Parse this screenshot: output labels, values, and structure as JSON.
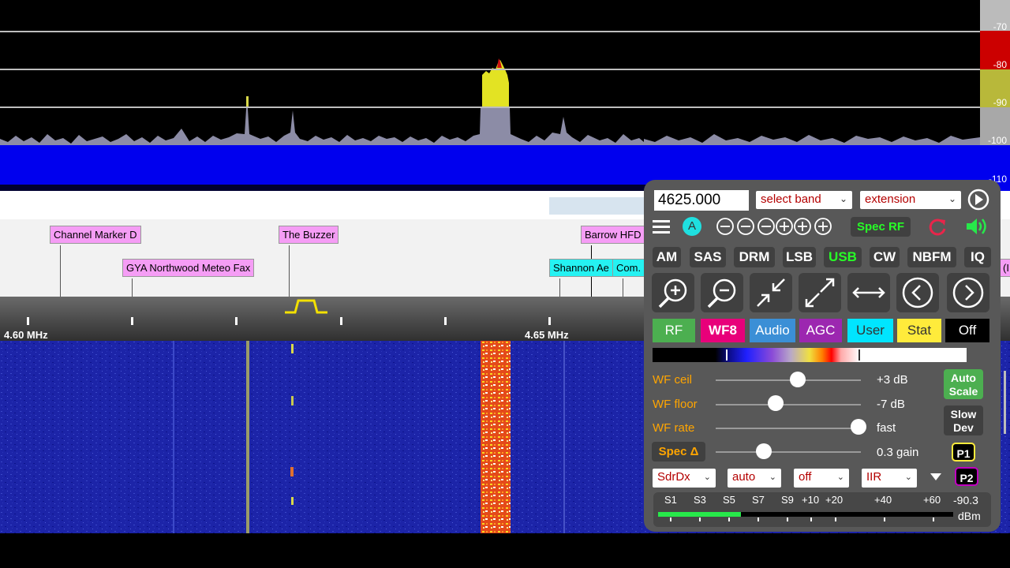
{
  "spectrum": {
    "db_scale": [
      "-70",
      "-80",
      "-90",
      "-100",
      "-110"
    ],
    "scale_colors": [
      "#bbbbbb",
      "#cc0000",
      "#b8b83a",
      "#a8a8a8",
      "#0000ee"
    ]
  },
  "markers": {
    "channel_marker_d": "Channel Marker D",
    "the_buzzer": "The Buzzer",
    "barrow_hfd": "Barrow HFD",
    "gya_northwood": "GYA Northwood Meteo Fax",
    "shannon": "Shannon Ae",
    "com": "Com.",
    "edge_partial": "(I"
  },
  "scale": {
    "left_label": "4.60 MHz",
    "mid_label": "4.65 MHz"
  },
  "controls": {
    "frequency": "4625.000",
    "select_band": "select band",
    "extension": "extension",
    "vfo": "A",
    "spec_rf": "Spec RF",
    "modes": [
      "AM",
      "SAS",
      "DRM",
      "LSB",
      "USB",
      "CW",
      "NBFM",
      "IQ"
    ],
    "active_mode": "USB",
    "tabs": [
      "RF",
      "WF8",
      "Audio",
      "AGC",
      "User",
      "Stat",
      "Off"
    ],
    "tab_colors": [
      "#4caf50",
      "#e8007a",
      "#3b8fd6",
      "#9c27b0",
      "#00e5ff",
      "#ffeb3b",
      "#000000"
    ],
    "tab_text_colors": [
      "#ffffff",
      "#ffffff",
      "#ffffff",
      "#ffffff",
      "#333333",
      "#333333",
      "#ffffff"
    ],
    "wf_ceil_label": "WF ceil",
    "wf_ceil_value": "+3 dB",
    "wf_floor_label": "WF floor",
    "wf_floor_value": "-7 dB",
    "wf_rate_label": "WF rate",
    "wf_rate_value": "fast",
    "spec_delta_label": "Spec Δ",
    "spec_delta_value": "0.3 gain",
    "auto_scale": "Auto Scale",
    "slow_dev": "Slow Dev",
    "p1": "P1",
    "p2": "P2",
    "sdrdx": "SdrDx",
    "auto": "auto",
    "off": "off",
    "iir": "IIR"
  },
  "smeter": {
    "labels": [
      "S1",
      "S3",
      "S5",
      "S7",
      "S9",
      "+10",
      "+20",
      "+40",
      "+60"
    ],
    "value": "-90.3",
    "unit": "dBm",
    "level": 0.28
  }
}
